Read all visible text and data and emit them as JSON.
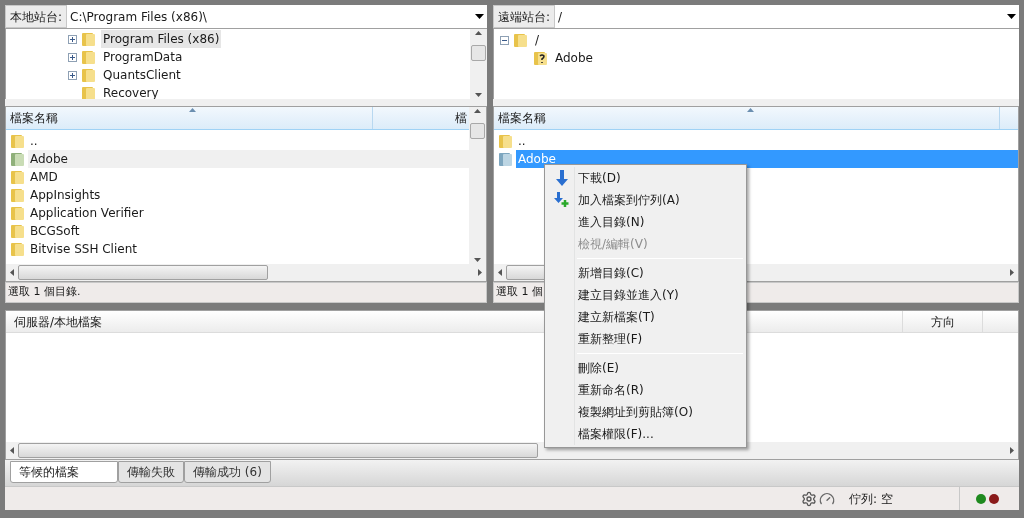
{
  "local": {
    "site_label": "本地站台:",
    "path": "C:\\Program Files (x86)\\",
    "tree": [
      {
        "name": "Program Files (x86)",
        "kind": "folder",
        "expanded": false,
        "selected": true
      },
      {
        "name": "ProgramData",
        "kind": "folder",
        "expanded": false,
        "selected": false
      },
      {
        "name": "QuantsClient",
        "kind": "folder",
        "expanded": false,
        "selected": false
      },
      {
        "name": "Recovery",
        "kind": "folder",
        "selected": false
      }
    ],
    "columns": [
      "檔案名稱",
      "檔"
    ],
    "files": [
      {
        "name": "..",
        "kind": "folder",
        "selected": false,
        "hovered": false
      },
      {
        "name": "Adobe",
        "kind": "shared",
        "selected": false,
        "hovered": true
      },
      {
        "name": "AMD",
        "kind": "folder",
        "selected": false,
        "hovered": false
      },
      {
        "name": "AppInsights",
        "kind": "folder",
        "selected": false,
        "hovered": false
      },
      {
        "name": "Application Verifier",
        "kind": "folder",
        "selected": false,
        "hovered": false
      },
      {
        "name": "BCGSoft",
        "kind": "folder",
        "selected": false,
        "hovered": false
      },
      {
        "name": "Bitvise SSH Client",
        "kind": "folder",
        "selected": false,
        "hovered": false
      }
    ],
    "status": "選取 1 個目錄."
  },
  "remote": {
    "site_label": "遠端站台:",
    "path": "/",
    "tree": [
      {
        "name": "/",
        "kind": "folder",
        "expanded": true,
        "selected": false,
        "children": [
          {
            "name": "Adobe",
            "kind": "unknown",
            "selected": false
          }
        ]
      }
    ],
    "columns": [
      "檔案名稱"
    ],
    "files": [
      {
        "name": "..",
        "kind": "folder",
        "selected": false,
        "hovered": false
      },
      {
        "name": "Adobe",
        "kind": "remote",
        "selected": true,
        "hovered": false
      }
    ],
    "status": "選取 1 個"
  },
  "context_menu": [
    {
      "kind": "download",
      "label": "下載(D)",
      "disabled": false
    },
    {
      "kind": "queue",
      "label": "加入檔案到佇列(A)",
      "disabled": false
    },
    {
      "kind": "item",
      "label": "進入目錄(N)",
      "disabled": false
    },
    {
      "kind": "item",
      "label": "檢視/編輯(V)",
      "disabled": true
    },
    {
      "kind": "separator"
    },
    {
      "kind": "item",
      "label": "新增目錄(C)",
      "disabled": false
    },
    {
      "kind": "item",
      "label": "建立目錄並進入(Y)",
      "disabled": false
    },
    {
      "kind": "item",
      "label": "建立新檔案(T)",
      "disabled": false
    },
    {
      "kind": "item",
      "label": "重新整理(F)",
      "disabled": false
    },
    {
      "kind": "separator"
    },
    {
      "kind": "item",
      "label": "刪除(E)",
      "disabled": false
    },
    {
      "kind": "item",
      "label": "重新命名(R)",
      "disabled": false
    },
    {
      "kind": "item",
      "label": "複製網址到剪貼簿(O)",
      "disabled": false
    },
    {
      "kind": "item",
      "label": "檔案權限(F)...",
      "disabled": false
    }
  ],
  "queue": {
    "columns": [
      "伺服器/本地檔案",
      "方向"
    ],
    "tabs": [
      {
        "label": "等候的檔案",
        "selected": true
      },
      {
        "label": "傳輸失敗",
        "selected": false
      },
      {
        "label": "傳輸成功 (6)",
        "selected": false
      }
    ]
  },
  "status_bar": {
    "queue_text": "佇列: 空",
    "lights": [
      {
        "color": "#1f8a1f"
      },
      {
        "color": "#8a1a1a"
      }
    ]
  }
}
